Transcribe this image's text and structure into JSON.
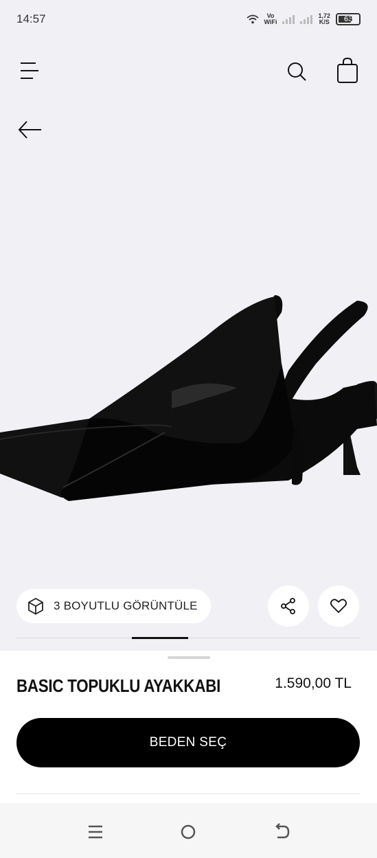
{
  "status_bar": {
    "time": "14:57",
    "wifi_label_top": "Vo",
    "wifi_label_bottom": "WiFi",
    "speed_value": "1,72",
    "speed_unit": "K/S",
    "battery_level": "63"
  },
  "top_nav": {
    "icons": [
      "menu-icon",
      "search-icon",
      "shopping-bag-icon",
      "back-arrow-icon"
    ]
  },
  "product": {
    "view_3d_label": "3 BOYUTLU GÖRÜNTÜLE",
    "name": "BASIC TOPUKLU AYAKKABI",
    "price": "1.590,00 TL",
    "size_button_label": "BEDEN SEÇ",
    "gallery_position": 0.39
  },
  "actions": {
    "icons": [
      "cube-3d-icon",
      "share-icon",
      "heart-icon"
    ]
  },
  "system_nav": {
    "icons": [
      "recents-icon",
      "home-icon",
      "back-icon"
    ]
  },
  "colors": {
    "background": "#f1f0f5",
    "primary_button": "#000000",
    "surface": "#ffffff"
  }
}
